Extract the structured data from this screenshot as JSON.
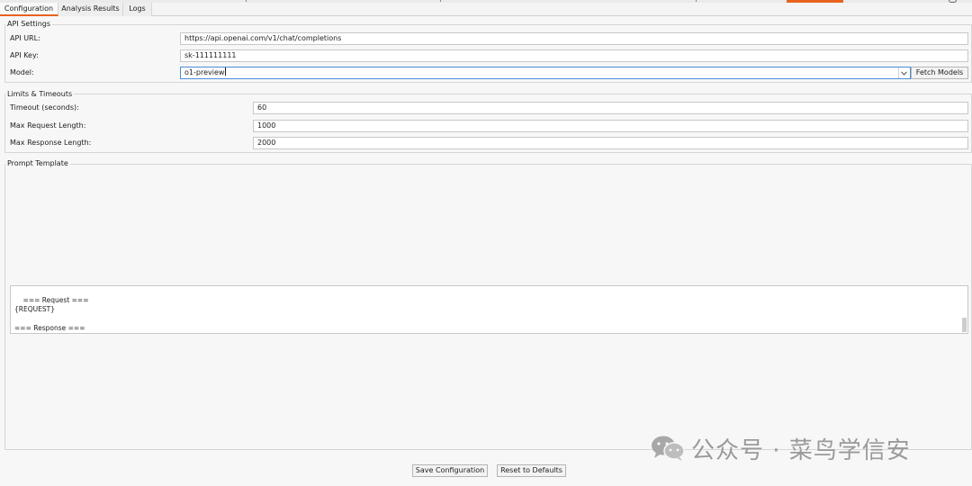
{
  "tabs": [
    {
      "label": "Configuration",
      "active": true
    },
    {
      "label": "Analysis Results",
      "active": false
    },
    {
      "label": "Logs",
      "active": false
    }
  ],
  "api_settings": {
    "title": "API Settings",
    "api_url_label": "API URL:",
    "api_url_value": "https://api.openai.com/v1/chat/completions",
    "api_key_label": "API Key:",
    "api_key_value": "sk-111111111",
    "model_label": "Model:",
    "model_value": "o1-preview",
    "fetch_models_label": "Fetch Models"
  },
  "limits": {
    "title": "Limits & Timeouts",
    "timeout_label": "Timeout (seconds):",
    "timeout_value": "60",
    "max_request_label": "Max Request Length:",
    "max_request_value": "1000",
    "max_response_label": "Max Response Length:",
    "max_response_value": "2000"
  },
  "prompt_template": {
    "title": "Prompt Template",
    "text": "=== Request ===\n{REQUEST}\n\n=== Response ===\n{RESPONSE}"
  },
  "footer": {
    "save_label": "Save Configuration",
    "reset_label": "Reset to Defaults"
  },
  "watermark": {
    "text": "公众号 · 菜鸟学信安",
    "icon": "wechat-icon"
  },
  "colors": {
    "accent": "#e8631f",
    "focus": "#4a8dd8",
    "background": "#f7f7f7"
  }
}
